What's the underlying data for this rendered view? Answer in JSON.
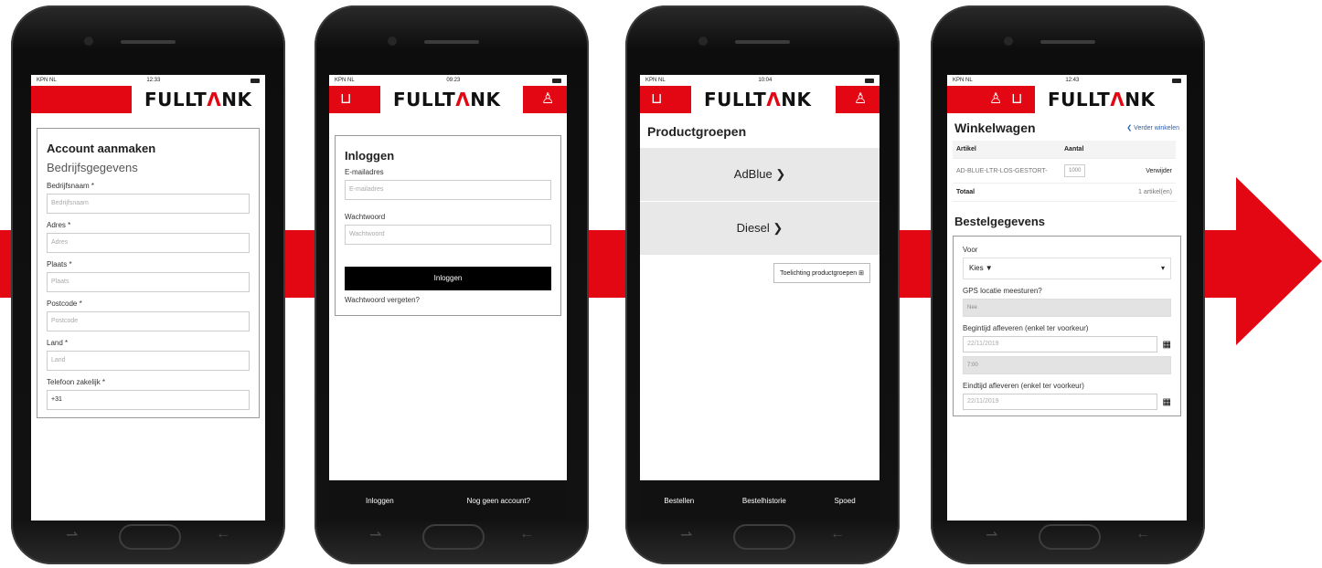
{
  "colors": {
    "brand_red": "#e30613",
    "footer_black": "#111111"
  },
  "logo": {
    "prefix": "FULLT",
    "accent": "Λ",
    "suffix": "NK"
  },
  "phone1": {
    "status": {
      "carrier": "KPN NL",
      "time": "12:33"
    },
    "heading": "Account aanmaken",
    "subheading": "Bedrijfsgegevens",
    "fields": [
      {
        "label": "Bedrijfsnaam *",
        "placeholder": "Bedrijfsnaam"
      },
      {
        "label": "Adres *",
        "placeholder": "Adres"
      },
      {
        "label": "Plaats *",
        "placeholder": "Plaats"
      },
      {
        "label": "Postcode *",
        "placeholder": "Postcode"
      },
      {
        "label": "Land *",
        "placeholder": "Land"
      },
      {
        "label": "Telefoon zakelijk *",
        "value": "+31"
      }
    ]
  },
  "phone2": {
    "status": {
      "carrier": "KPN NL",
      "time": "09:23"
    },
    "heading": "Inloggen",
    "email_label": "E-mailadres",
    "email_placeholder": "E-mailadres",
    "password_label": "Wachtwoord",
    "password_placeholder": "Wachtwoord",
    "login_button": "Inloggen",
    "forgot_link": "Wachtwoord vergeten?",
    "footer": {
      "left": "Inloggen",
      "right": "Nog geen account?"
    }
  },
  "phone3": {
    "status": {
      "carrier": "KPN NL",
      "time": "10:04"
    },
    "heading": "Productgroepen",
    "groups": [
      "AdBlue ❯",
      "Diesel ❯"
    ],
    "explain_button": "Toelichting productgroepen",
    "footer": {
      "left": "Bestellen",
      "middle": "Bestelhistorie",
      "right": "Spoed"
    }
  },
  "phone4": {
    "status": {
      "carrier": "KPN NL",
      "time": "12:43"
    },
    "heading": "Winkelwagen",
    "continue_link": "❮ Verder winkelen",
    "table": {
      "col_article": "Artikel",
      "col_amount": "Aantal",
      "item_name": "AD-BLUE-LTR-LOS-GESTORT-",
      "item_qty": "1000",
      "remove": "Verwijder",
      "total_label": "Totaal",
      "total_value": "1 artikel(en)"
    },
    "order_heading": "Bestelgegevens",
    "voor_label": "Voor",
    "voor_value": "Kies ▼",
    "gps_label": "GPS locatie meesturen?",
    "gps_value": "Nee",
    "start_label": "Begintijd afleveren (enkel ter voorkeur)",
    "start_date": "22/11/2019",
    "start_time": "7:00",
    "end_label": "Eindtijd afleveren (enkel ter voorkeur)",
    "end_date": "22/11/2019"
  }
}
